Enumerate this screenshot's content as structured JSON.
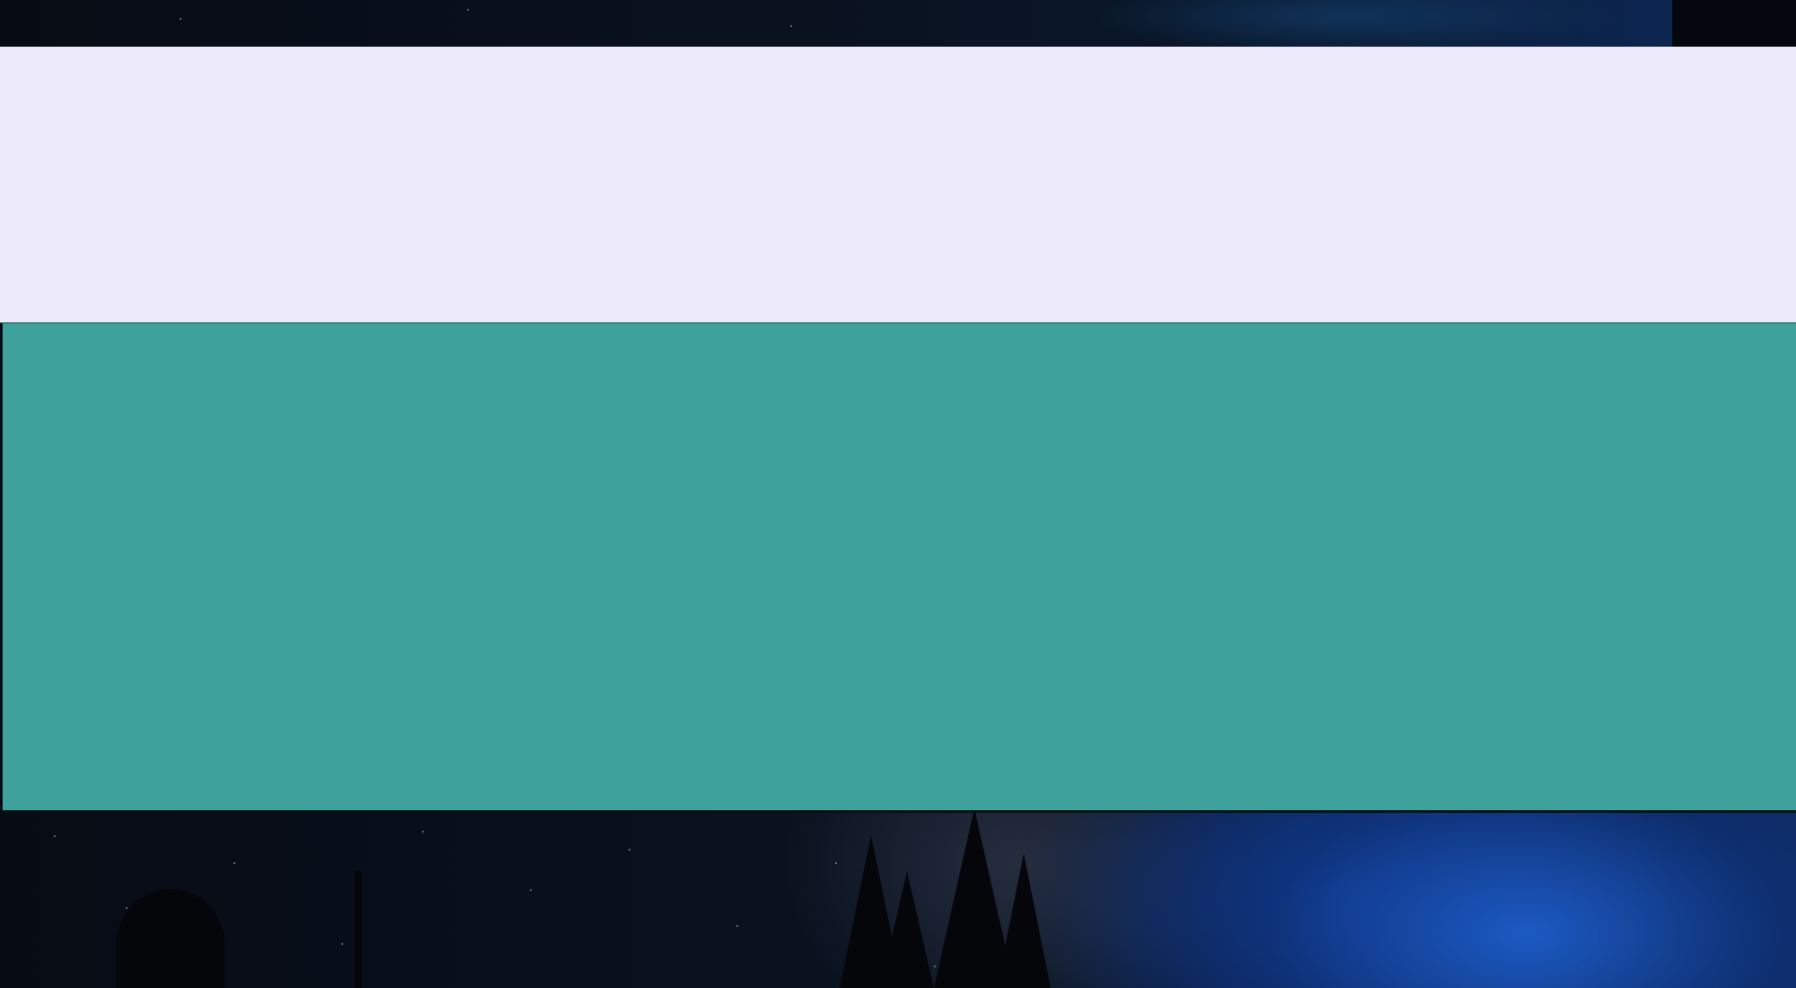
{
  "background": {
    "icon": "night-sky-wallpaper",
    "colors": {
      "sky": "#070b14",
      "glow": "#1c5cc8"
    }
  },
  "panels": {
    "light": {
      "color": "#edebf9"
    },
    "teal": {
      "color": "#3ea19b"
    }
  }
}
